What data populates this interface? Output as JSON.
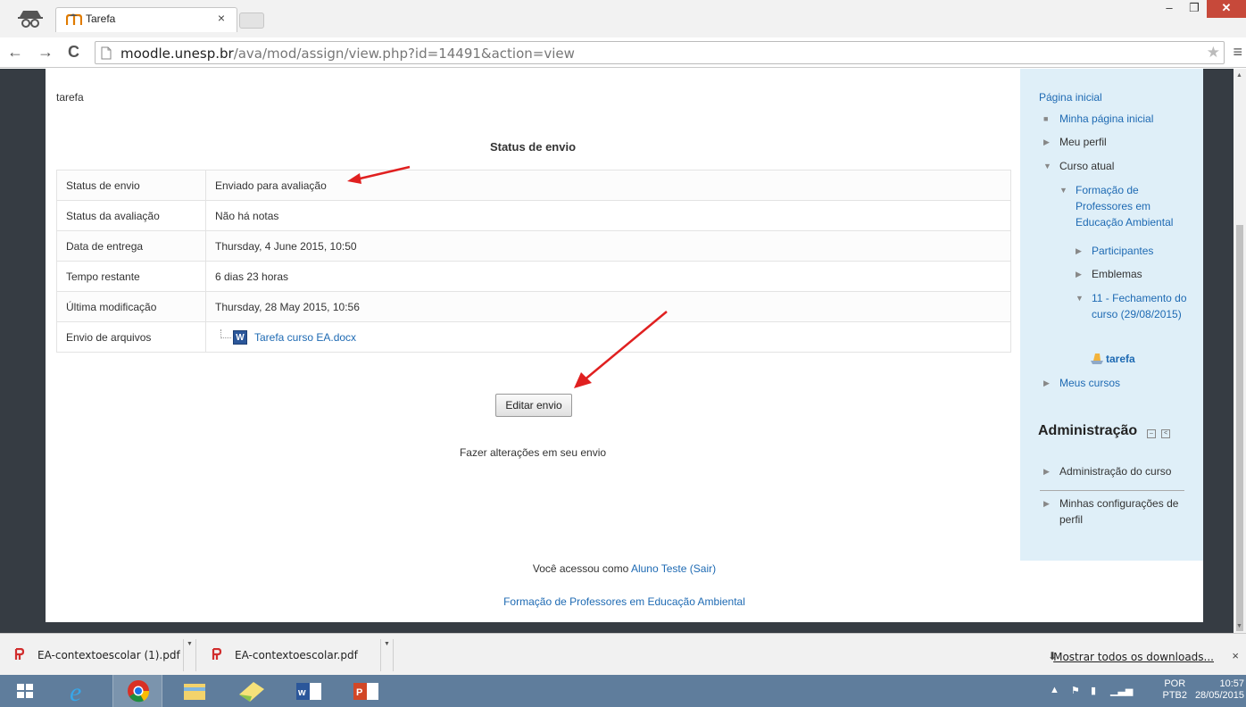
{
  "browser": {
    "tab_title": "Tarefa",
    "tab_close": "×",
    "url_host": "moodle.unesp.br",
    "url_path": "/ava/mod/assign/view.php?id=14491&action=view",
    "window_controls": [
      "–",
      "❐",
      "✕"
    ]
  },
  "main": {
    "pre_title": "tarefa",
    "heading": "Status de envio",
    "rows": [
      {
        "label": "Status de envio",
        "value": "Enviado para avaliação"
      },
      {
        "label": "Status da avaliação",
        "value": "Não há notas"
      },
      {
        "label": "Data de entrega",
        "value": "Thursday, 4 June 2015, 10:50"
      },
      {
        "label": "Tempo restante",
        "value": "6 dias 23 horas"
      },
      {
        "label": "Última modificação",
        "value": "Thursday, 28 May 2015, 10:56"
      },
      {
        "label": "Envio de arquivos",
        "file": "Tarefa curso EA.docx",
        "file_icon": "W"
      }
    ],
    "edit_button": "Editar envio",
    "edit_desc": "Fazer alterações em seu envio"
  },
  "sidebar": {
    "nav_title": "Página inicial",
    "items": [
      {
        "text": "Minha página inicial",
        "link": true,
        "mark": "■"
      },
      {
        "text": "Meu perfil",
        "link": false,
        "mark": "▶"
      },
      {
        "text": "Curso atual",
        "link": false,
        "mark": "▼"
      },
      {
        "text": "Formação de Professores em Educação Ambiental",
        "link": true,
        "mark": "▼"
      },
      {
        "text": "Participantes",
        "link": true,
        "mark": "▶"
      },
      {
        "text": "Emblemas",
        "link": false,
        "mark": "▶"
      },
      {
        "text": "11 - Fechamento do curso (29/08/2015)",
        "link": true,
        "mark": "▼"
      },
      {
        "text": "tarefa",
        "link": true,
        "mark": ""
      },
      {
        "text": "Meus cursos",
        "link": true,
        "mark": "▶"
      }
    ],
    "admin_title": "Administração",
    "admin_items": [
      {
        "text": "Administração do curso",
        "mark": "▶"
      },
      {
        "text": "Minhas configurações de perfil",
        "mark": "▶"
      }
    ]
  },
  "footer": {
    "logged_prefix": "Você acessou como ",
    "user": "Aluno Teste",
    "logout": "(Sair)",
    "course_link": "Formação de Professores em Educação Ambiental"
  },
  "downloads": {
    "items": [
      "EA-contextoescolar (1).pdf",
      "EA-contextoescolar.pdf"
    ],
    "show_all": "Mostrar todos os downloads...",
    "close": "×"
  },
  "taskbar": {
    "lang_top": "POR",
    "lang_bottom": "PTB2",
    "time": "10:57",
    "date": "28/05/2015"
  },
  "colors": {
    "link": "#1e6ab3",
    "sidebar_bg": "#dfeff8",
    "page_bg": "#363c43",
    "taskbar": "#5f7d9c",
    "arrow": "#e02020"
  }
}
